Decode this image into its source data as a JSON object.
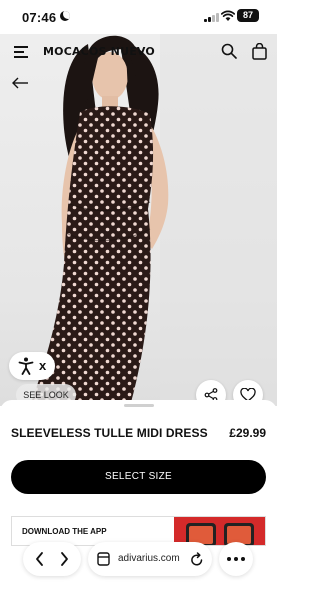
{
  "status_bar": {
    "time": "07:46",
    "battery": "87",
    "icons": [
      "moon-icon",
      "signal-icon",
      "wifi-icon",
      "battery-icon"
    ]
  },
  "header": {
    "brand": "MOCACOS NUEVO",
    "icons": [
      "menu-icon",
      "search-icon",
      "shopping-bag-icon",
      "back-arrow-icon"
    ]
  },
  "hero": {
    "accessibility_icon": "accessibility-icon",
    "close_label": "x",
    "see_look_label": "SEE LOOK",
    "share_icon": "share-icon",
    "favorite_icon": "heart-icon"
  },
  "product": {
    "name": "SLEEVELESS TULLE MIDI DRESS",
    "price": "£29.99",
    "select_size_label": "SELECT SIZE"
  },
  "app_banner": {
    "text": "DOWNLOAD THE APP",
    "promo_color": "#d42a2a"
  },
  "browser": {
    "url": "adivarius.com",
    "icons": [
      "chevron-left-icon",
      "chevron-right-icon",
      "tabs-icon",
      "reload-icon",
      "more-icon"
    ]
  },
  "colors": {
    "primary_button": "#000000",
    "accent_red": "#d42a2a",
    "dress_dark": "#2a1a17",
    "dots": "#f0d9d2"
  }
}
